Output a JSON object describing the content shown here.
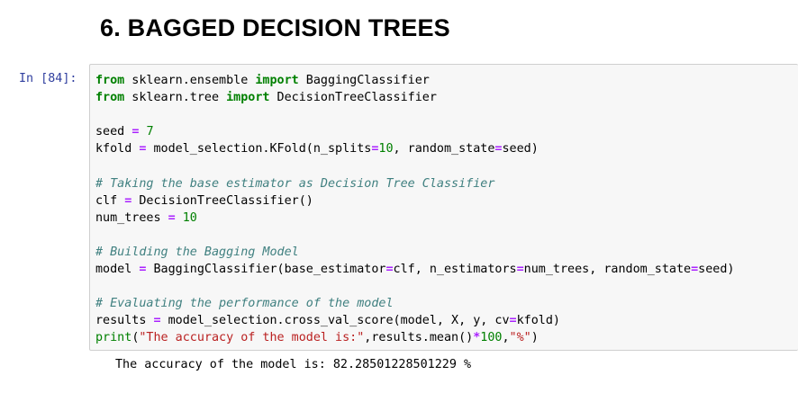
{
  "section_title": "6. BAGGED DECISION TREES",
  "cell": {
    "prompt": "In [84]:",
    "code": {
      "l1_kw_from": "from",
      "l1_module": " sklearn.ensemble ",
      "l1_kw_import": "import",
      "l1_name": " BaggingClassifier",
      "l2_kw_from": "from",
      "l2_module": " sklearn.tree ",
      "l2_kw_import": "import",
      "l2_name": " DecisionTreeClassifier",
      "l4_var": "seed ",
      "l4_eq": "=",
      "l4_sp": " ",
      "l4_num": "7",
      "l5_a": "kfold ",
      "l5_eq": "=",
      "l5_b": " model_selection.KFold(n_splits",
      "l5_eq2": "=",
      "l5_num": "10",
      "l5_c": ", random_state",
      "l5_eq3": "=",
      "l5_d": "seed)",
      "l7_comment": "# Taking the base estimator as Decision Tree Classifier",
      "l8_a": "clf ",
      "l8_eq": "=",
      "l8_b": " DecisionTreeClassifier()",
      "l9_a": "num_trees ",
      "l9_eq": "=",
      "l9_sp": " ",
      "l9_num": "10",
      "l11_comment": "# Building the Bagging Model",
      "l12_a": "model ",
      "l12_eq": "=",
      "l12_b": " BaggingClassifier(base_estimator",
      "l12_eq2": "=",
      "l12_c": "clf, n_estimators",
      "l12_eq3": "=",
      "l12_d": "num_trees, random_state",
      "l12_eq4": "=",
      "l12_e": "seed)",
      "l14_comment": "# Evaluating the performance of the model",
      "l15_a": "results ",
      "l15_eq": "=",
      "l15_b": " model_selection.cross_val_score(model, X, y, cv",
      "l15_eq2": "=",
      "l15_c": "kfold)",
      "l16_print": "print",
      "l16_a": "(",
      "l16_str1": "\"The accuracy of the model is:\"",
      "l16_b": ",results.mean()",
      "l16_op": "*",
      "l16_num": "100",
      "l16_c": ",",
      "l16_str2": "\"%\"",
      "l16_d": ")"
    },
    "output": "The accuracy of the model is: 82.28501228501229 %"
  }
}
